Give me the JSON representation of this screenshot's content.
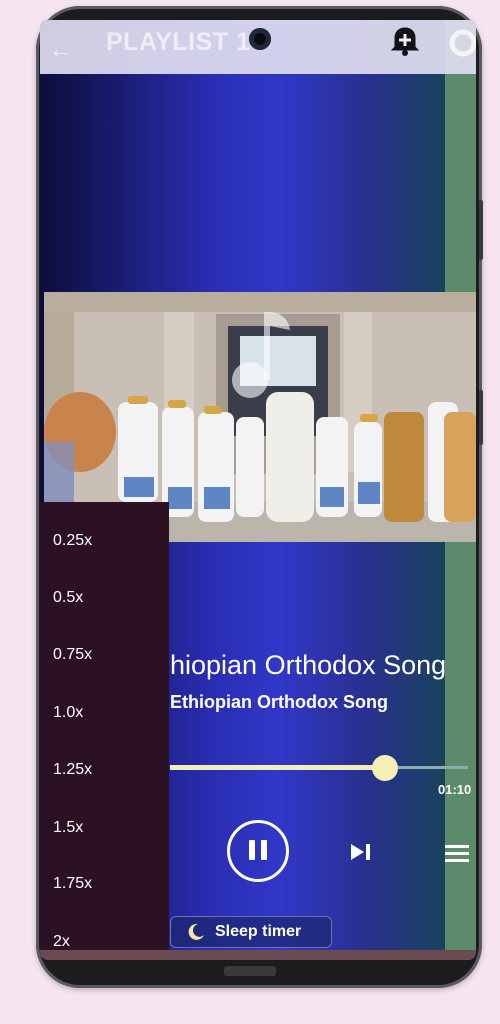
{
  "header": {
    "title": "PLAYLIST 1",
    "back_icon": "arrow-left-icon",
    "alarm_icon": "alarm-add-icon",
    "settings_icon": "settings-icon"
  },
  "artwork": {
    "icon": "music-note-icon"
  },
  "speed_menu": {
    "items": [
      "0.25x",
      "0.5x",
      "0.75x",
      "1.0x",
      "1.25x",
      "1.5x",
      "1.75x",
      "2x"
    ]
  },
  "song": {
    "title": "hiopian Orthodox Song",
    "subtitle": "Ethiopian Orthodox Song"
  },
  "player": {
    "total_time": "01:10",
    "progress_fraction": 0.72,
    "pause_icon": "pause-icon",
    "next_icon": "skip-next-icon",
    "queue_icon": "queue-list-icon"
  },
  "sleep_timer": {
    "label": "Sleep timer",
    "icon": "moon-icon"
  },
  "colors": {
    "accent_progress": "#f3eeb8",
    "menu_background": "#2c1124",
    "gradient_mid": "#3137c8"
  }
}
